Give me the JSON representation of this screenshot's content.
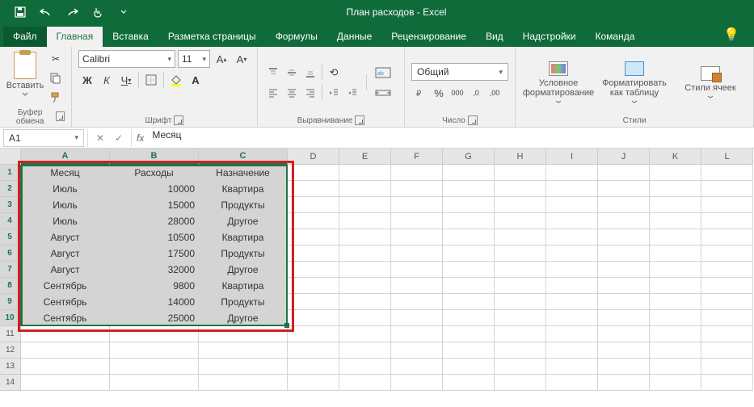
{
  "app_title": "План расходов - Excel",
  "tabs": {
    "file": "Файл",
    "items": [
      "Главная",
      "Вставка",
      "Разметка страницы",
      "Формулы",
      "Данные",
      "Рецензирование",
      "Вид",
      "Надстройки",
      "Команда"
    ],
    "active": "Главная"
  },
  "ribbon": {
    "clipboard": {
      "paste": "Вставить",
      "label": "Буфер обмена"
    },
    "font": {
      "name": "Calibri",
      "size": "11",
      "label": "Шрифт",
      "bold": "Ж",
      "italic": "К",
      "under": "Ч"
    },
    "alignment": {
      "label": "Выравнивание"
    },
    "number": {
      "format": "Общий",
      "label": "Число"
    },
    "styles": {
      "cond": "Условное форматирование",
      "fmt": "Форматировать как таблицу",
      "cell": "Стили ячеек",
      "label": "Стили"
    }
  },
  "formula_bar": {
    "cell_ref": "A1",
    "content": "Месяц"
  },
  "columns": [
    "A",
    "B",
    "C",
    "D",
    "E",
    "F",
    "G",
    "H",
    "I",
    "J",
    "K",
    "L"
  ],
  "table": {
    "headers": [
      "Месяц",
      "Расходы",
      "Назначение"
    ],
    "rows": [
      [
        "Июль",
        "10000",
        "Квартира"
      ],
      [
        "Июль",
        "15000",
        "Продукты"
      ],
      [
        "Июль",
        "28000",
        "Другое"
      ],
      [
        "Август",
        "10500",
        "Квартира"
      ],
      [
        "Август",
        "17500",
        "Продукты"
      ],
      [
        "Август",
        "32000",
        "Другое"
      ],
      [
        "Сентябрь",
        "9800",
        "Квартира"
      ],
      [
        "Сентябрь",
        "14000",
        "Продукты"
      ],
      [
        "Сентябрь",
        "25000",
        "Другое"
      ]
    ]
  }
}
